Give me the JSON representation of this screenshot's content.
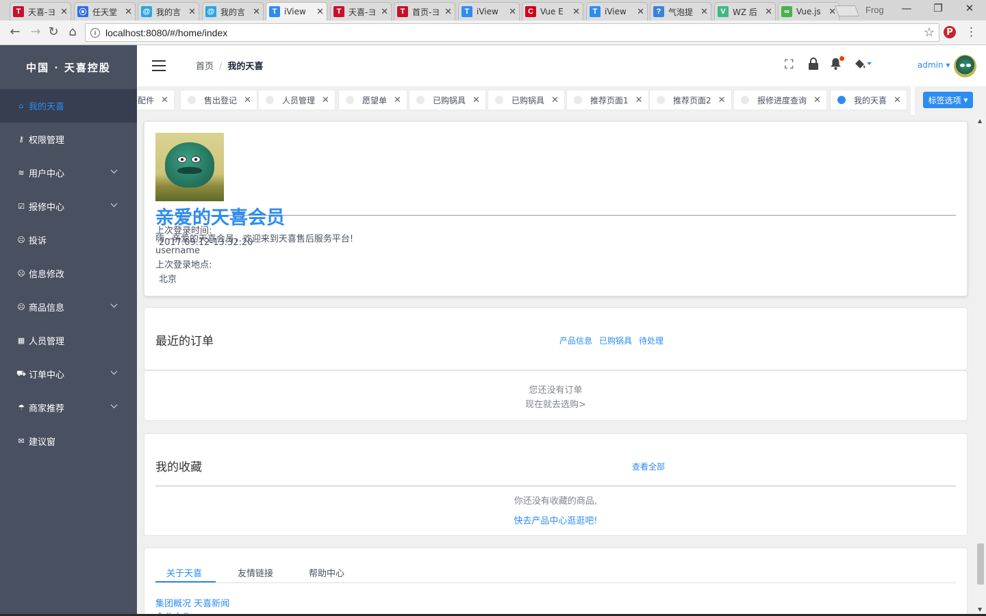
{
  "browser": {
    "tabs": [
      {
        "title": "天喜-ヨ",
        "icon_text": "T",
        "icon_color": "#c8102e"
      },
      {
        "title": "任天堂",
        "icon_text": "⦿",
        "icon_color": "#2f6de1"
      },
      {
        "title": "我的言",
        "icon_text": "@",
        "icon_color": "#2aa6e0"
      },
      {
        "title": "我的言",
        "icon_text": "@",
        "icon_color": "#2aa6e0"
      },
      {
        "title": "iView",
        "icon_text": "T",
        "icon_color": "#2d8cf0"
      },
      {
        "title": "天喜-ヨ",
        "icon_text": "T",
        "icon_color": "#c8102e"
      },
      {
        "title": "首页-ヨ",
        "icon_text": "T",
        "icon_color": "#c8102e"
      },
      {
        "title": "iView",
        "icon_text": "T",
        "icon_color": "#2d8cf0"
      },
      {
        "title": "Vue E",
        "icon_text": "C",
        "icon_color": "#d0021b"
      },
      {
        "title": "iView",
        "icon_text": "T",
        "icon_color": "#2d8cf0"
      },
      {
        "title": "气泡提",
        "icon_text": "?",
        "icon_color": "#3b82d6"
      },
      {
        "title": "WZ 后",
        "icon_text": "V",
        "icon_color": "#41b883"
      },
      {
        "title": "Vue.js",
        "icon_text": "∞",
        "icon_color": "#4caf50"
      }
    ],
    "active_tab_index": 4,
    "profile_label": "Frog",
    "url": "localhost:8080/#/home/index",
    "window_controls": {
      "minimize": "—",
      "restore": "❐",
      "close": "✕"
    }
  },
  "sidebar": {
    "logo": "中国 · 天喜控股",
    "items": [
      {
        "label": "我的天喜",
        "icon": "home-icon",
        "glyph": "⌂",
        "has_submenu": false,
        "active": true
      },
      {
        "label": "权限管理",
        "icon": "key-icon",
        "glyph": "⚷",
        "has_submenu": false
      },
      {
        "label": "用户中心",
        "icon": "layers-icon",
        "glyph": "≋",
        "has_submenu": true
      },
      {
        "label": "报修中心",
        "icon": "checkbox-icon",
        "glyph": "☑",
        "has_submenu": true
      },
      {
        "label": "投诉",
        "icon": "sad-face-icon",
        "glyph": "☹",
        "has_submenu": false
      },
      {
        "label": "信息修改",
        "icon": "sad-face-icon",
        "glyph": "☹",
        "has_submenu": false
      },
      {
        "label": "商品信息",
        "icon": "sad-face-icon",
        "glyph": "☹",
        "has_submenu": true
      },
      {
        "label": "人员管理",
        "icon": "grid-icon",
        "glyph": "▦",
        "has_submenu": false
      },
      {
        "label": "订单中心",
        "icon": "cart-icon",
        "glyph": "⛟",
        "has_submenu": true
      },
      {
        "label": "商家推荐",
        "icon": "umbrella-icon",
        "glyph": "☂",
        "has_submenu": true
      },
      {
        "label": "建议窗",
        "icon": "chat-icon",
        "glyph": "✉",
        "has_submenu": false
      }
    ]
  },
  "header": {
    "breadcrumb": [
      "首页",
      "我的天喜"
    ],
    "user_name": "admin"
  },
  "tags": {
    "items": [
      {
        "label": "配件",
        "active": false
      },
      {
        "label": "售出登记",
        "active": false
      },
      {
        "label": "人员管理",
        "active": false
      },
      {
        "label": "愿望单",
        "active": false
      },
      {
        "label": "已购锅具",
        "active": false
      },
      {
        "label": "已购锅具",
        "active": false
      },
      {
        "label": "推荐页面1",
        "active": false
      },
      {
        "label": "推荐页面2",
        "active": false
      },
      {
        "label": "报修进度查询",
        "active": false
      },
      {
        "label": "我的天喜",
        "active": true
      }
    ],
    "options_label": "标签选项"
  },
  "profile_card": {
    "title": "亲爱的天喜会员",
    "last_login_time_label": "上次登录时间:",
    "greeting": "嗨~亲爱的天喜会员，欢迎来到天喜售后服务平台!",
    "last_login_time": "2017.09.12-13:32:20",
    "username": "username",
    "last_login_place_label": "上次登录地点:",
    "last_login_place": "北京"
  },
  "orders": {
    "title": "最近的订单",
    "links": [
      "产品信息",
      "已购锅具",
      "待处理"
    ],
    "empty_text": "您还没有订单",
    "shop_link": "现在就去选购>"
  },
  "favorites": {
    "title": "我的收藏",
    "view_all": "查看全部",
    "empty_text": "你还没有收藏的商品,",
    "browse_link": "快去产品中心逛逛吧!"
  },
  "footer": {
    "tabs": [
      "关于天喜",
      "友情链接",
      "帮助中心"
    ],
    "active_tab": 0,
    "links": [
      "集团概况 天喜新闻",
      "企业文化"
    ]
  }
}
